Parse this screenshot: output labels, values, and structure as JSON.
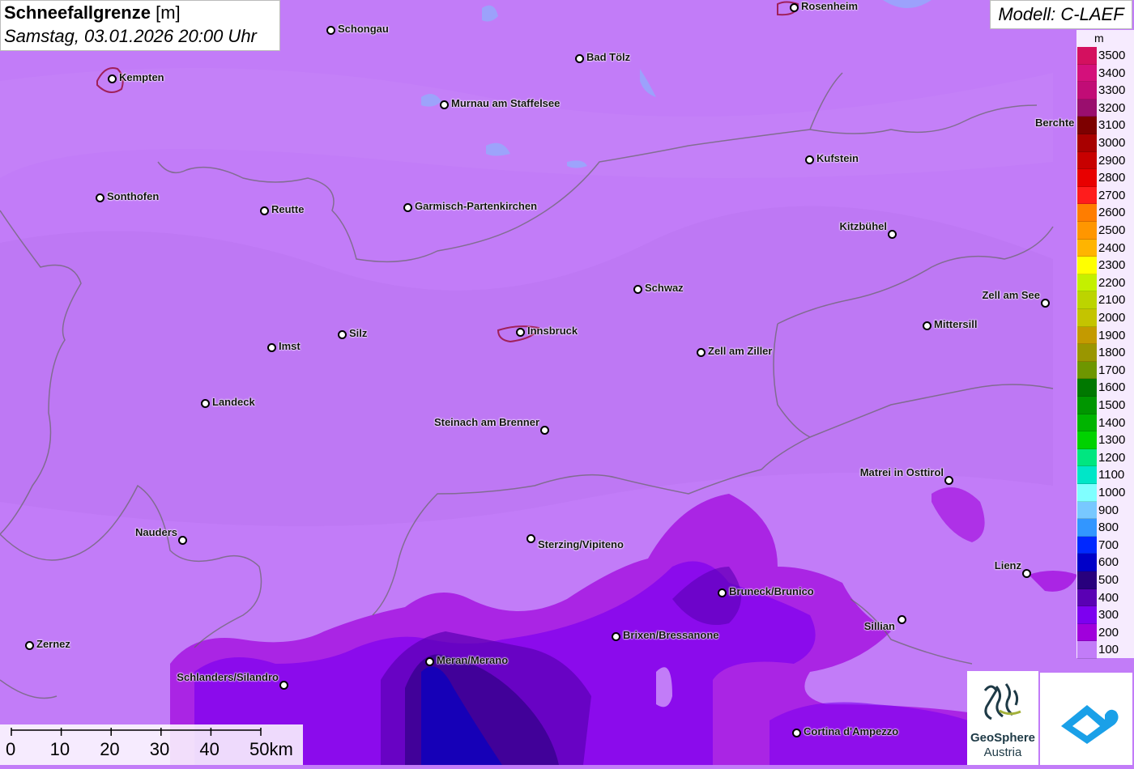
{
  "title": {
    "param": "Schneefallgrenze",
    "unit": "[m]",
    "datetime": "Samstag, 03.01.2026 20:00 Uhr"
  },
  "model": "Modell: C-LAEF",
  "legend": {
    "unit": "m",
    "items": [
      {
        "label": "3500",
        "color": "#d4105f"
      },
      {
        "label": "3400",
        "color": "#d4107b"
      },
      {
        "label": "3300",
        "color": "#c10c76"
      },
      {
        "label": "3200",
        "color": "#9a0e6e"
      },
      {
        "label": "3100",
        "color": "#7d0000"
      },
      {
        "label": "3000",
        "color": "#a80000"
      },
      {
        "label": "2900",
        "color": "#c80000"
      },
      {
        "label": "2800",
        "color": "#e80000"
      },
      {
        "label": "2700",
        "color": "#ff1c1c"
      },
      {
        "label": "2600",
        "color": "#ff7d00"
      },
      {
        "label": "2500",
        "color": "#ff9600"
      },
      {
        "label": "2400",
        "color": "#ffb400"
      },
      {
        "label": "2300",
        "color": "#ffff00"
      },
      {
        "label": "2200",
        "color": "#c4f000"
      },
      {
        "label": "2100",
        "color": "#bcd400"
      },
      {
        "label": "2000",
        "color": "#c4c400"
      },
      {
        "label": "1900",
        "color": "#c49a00"
      },
      {
        "label": "1800",
        "color": "#9a9600"
      },
      {
        "label": "1700",
        "color": "#6e9600"
      },
      {
        "label": "1600",
        "color": "#007800"
      },
      {
        "label": "1500",
        "color": "#009600"
      },
      {
        "label": "1400",
        "color": "#00b400"
      },
      {
        "label": "1300",
        "color": "#00d200"
      },
      {
        "label": "1200",
        "color": "#00e680"
      },
      {
        "label": "1100",
        "color": "#00e6c8"
      },
      {
        "label": "1000",
        "color": "#80ffff"
      },
      {
        "label": "900",
        "color": "#78c8ff"
      },
      {
        "label": "800",
        "color": "#3296ff"
      },
      {
        "label": "700",
        "color": "#0028ff"
      },
      {
        "label": "600",
        "color": "#0000c8"
      },
      {
        "label": "500",
        "color": "#28007d"
      },
      {
        "label": "400",
        "color": "#5a00b4"
      },
      {
        "label": "300",
        "color": "#7d00f0"
      },
      {
        "label": "200",
        "color": "#a000dc"
      },
      {
        "label": "100",
        "color": "#c27cf8"
      }
    ]
  },
  "cities": [
    {
      "name": "Rosenheim"
    },
    {
      "name": "Schongau"
    },
    {
      "name": "Kempten"
    },
    {
      "name": "Bad Tölz"
    },
    {
      "name": "Murnau am Staffelsee"
    },
    {
      "name": "Berchte"
    },
    {
      "name": "Kufstein"
    },
    {
      "name": "Sonthofen"
    },
    {
      "name": "Reutte"
    },
    {
      "name": "Garmisch-Partenkirchen"
    },
    {
      "name": "Kitzbühel"
    },
    {
      "name": "Schwaz"
    },
    {
      "name": "Zell am See"
    },
    {
      "name": "Mittersill"
    },
    {
      "name": "Silz"
    },
    {
      "name": "Innsbruck"
    },
    {
      "name": "Imst"
    },
    {
      "name": "Zell am Ziller"
    },
    {
      "name": "Landeck"
    },
    {
      "name": "Steinach am Brenner"
    },
    {
      "name": "Matrei in Osttirol"
    },
    {
      "name": "Nauders"
    },
    {
      "name": "Sterzing/Vipiteno"
    },
    {
      "name": "Lienz"
    },
    {
      "name": "Bruneck/Brunico"
    },
    {
      "name": "Sillian"
    },
    {
      "name": "Brixen/Bressanone"
    },
    {
      "name": "Zernez"
    },
    {
      "name": "Meran/Merano"
    },
    {
      "name": "Schlanders/Silandro"
    },
    {
      "name": "Cortina d'Ampezzo"
    }
  ],
  "scale": {
    "labels": [
      "0",
      "10",
      "20",
      "30",
      "40",
      "50km"
    ]
  },
  "logos": {
    "geosphere_line1": "GeoSphere",
    "geosphere_line2": "Austria"
  }
}
